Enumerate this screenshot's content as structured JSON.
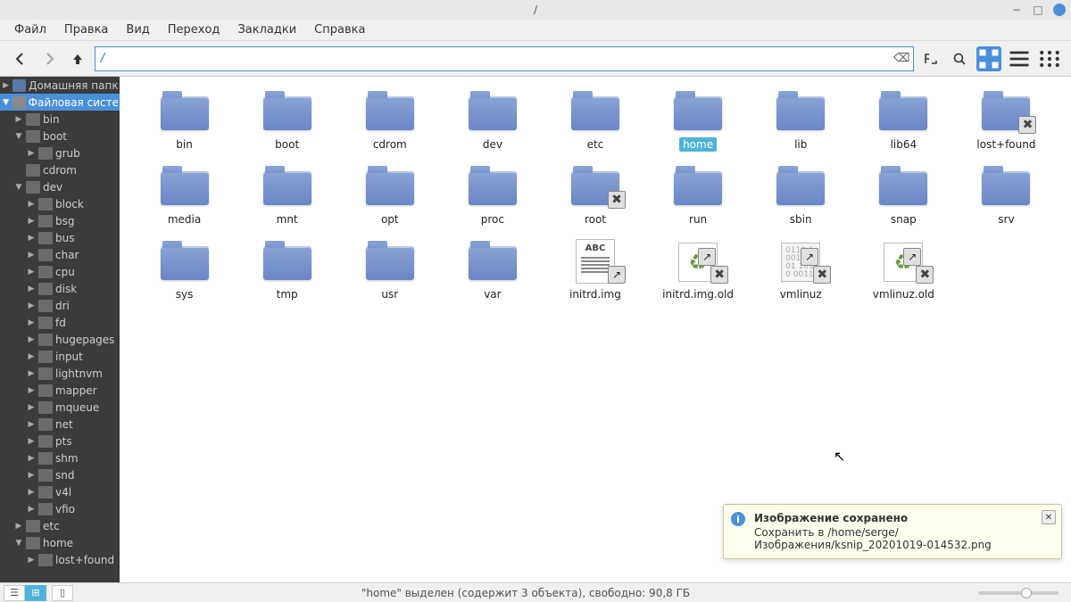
{
  "window": {
    "title": "/"
  },
  "menu": [
    "Файл",
    "Правка",
    "Вид",
    "Переход",
    "Закладки",
    "Справка"
  ],
  "path": {
    "value": "/"
  },
  "tree": [
    {
      "d": 0,
      "label": "Домашняя папка",
      "icon": "home",
      "arrow": "col",
      "sel": false
    },
    {
      "d": 0,
      "label": "Файловая систем",
      "icon": "hdd",
      "arrow": "exp",
      "sel": true
    },
    {
      "d": 1,
      "label": "bin",
      "icon": "folder",
      "arrow": "col",
      "sel": false
    },
    {
      "d": 1,
      "label": "boot",
      "icon": "folder",
      "arrow": "exp",
      "sel": false
    },
    {
      "d": 2,
      "label": "grub",
      "icon": "folder",
      "arrow": "col",
      "sel": false
    },
    {
      "d": 1,
      "label": "cdrom",
      "icon": "folder",
      "arrow": "none",
      "sel": false
    },
    {
      "d": 1,
      "label": "dev",
      "icon": "folder",
      "arrow": "exp",
      "sel": false
    },
    {
      "d": 2,
      "label": "block",
      "icon": "folder",
      "arrow": "col",
      "sel": false
    },
    {
      "d": 2,
      "label": "bsg",
      "icon": "folder",
      "arrow": "col",
      "sel": false
    },
    {
      "d": 2,
      "label": "bus",
      "icon": "folder",
      "arrow": "col",
      "sel": false
    },
    {
      "d": 2,
      "label": "char",
      "icon": "folder",
      "arrow": "col",
      "sel": false
    },
    {
      "d": 2,
      "label": "cpu",
      "icon": "folder",
      "arrow": "col",
      "sel": false
    },
    {
      "d": 2,
      "label": "disk",
      "icon": "folder",
      "arrow": "col",
      "sel": false
    },
    {
      "d": 2,
      "label": "dri",
      "icon": "folder",
      "arrow": "col",
      "sel": false
    },
    {
      "d": 2,
      "label": "fd",
      "icon": "folder",
      "arrow": "col",
      "sel": false
    },
    {
      "d": 2,
      "label": "hugepages",
      "icon": "folder",
      "arrow": "col",
      "sel": false
    },
    {
      "d": 2,
      "label": "input",
      "icon": "folder",
      "arrow": "col",
      "sel": false
    },
    {
      "d": 2,
      "label": "lightnvm",
      "icon": "folder",
      "arrow": "col",
      "sel": false
    },
    {
      "d": 2,
      "label": "mapper",
      "icon": "folder",
      "arrow": "col",
      "sel": false
    },
    {
      "d": 2,
      "label": "mqueue",
      "icon": "folder",
      "arrow": "col",
      "sel": false
    },
    {
      "d": 2,
      "label": "net",
      "icon": "folder",
      "arrow": "col",
      "sel": false
    },
    {
      "d": 2,
      "label": "pts",
      "icon": "folder",
      "arrow": "col",
      "sel": false
    },
    {
      "d": 2,
      "label": "shm",
      "icon": "folder",
      "arrow": "col",
      "sel": false
    },
    {
      "d": 2,
      "label": "snd",
      "icon": "folder",
      "arrow": "col",
      "sel": false
    },
    {
      "d": 2,
      "label": "v4l",
      "icon": "folder",
      "arrow": "col",
      "sel": false
    },
    {
      "d": 2,
      "label": "vfio",
      "icon": "folder",
      "arrow": "col",
      "sel": false
    },
    {
      "d": 1,
      "label": "etc",
      "icon": "folder",
      "arrow": "col",
      "sel": false
    },
    {
      "d": 1,
      "label": "home",
      "icon": "folder",
      "arrow": "exp",
      "sel": false
    },
    {
      "d": 2,
      "label": "lost+found",
      "icon": "lost",
      "arrow": "col",
      "sel": false
    }
  ],
  "icons": [
    {
      "label": "bin",
      "type": "folder"
    },
    {
      "label": "boot",
      "type": "folder"
    },
    {
      "label": "cdrom",
      "type": "folder"
    },
    {
      "label": "dev",
      "type": "folder"
    },
    {
      "label": "etc",
      "type": "folder"
    },
    {
      "label": "home",
      "type": "folder",
      "sel": true
    },
    {
      "label": "lib",
      "type": "folder"
    },
    {
      "label": "lib64",
      "type": "folder"
    },
    {
      "label": "lost+found",
      "type": "folder",
      "locked": true
    },
    {
      "label": "media",
      "type": "folder"
    },
    {
      "label": "mnt",
      "type": "folder"
    },
    {
      "label": "opt",
      "type": "folder"
    },
    {
      "label": "proc",
      "type": "folder"
    },
    {
      "label": "root",
      "type": "folder",
      "locked": true
    },
    {
      "label": "run",
      "type": "folder"
    },
    {
      "label": "sbin",
      "type": "folder"
    },
    {
      "label": "snap",
      "type": "folder"
    },
    {
      "label": "srv",
      "type": "folder"
    },
    {
      "label": "sys",
      "type": "folder"
    },
    {
      "label": "tmp",
      "type": "folder"
    },
    {
      "label": "usr",
      "type": "folder"
    },
    {
      "label": "var",
      "type": "folder"
    },
    {
      "label": "initrd.img",
      "type": "textlink",
      "badge": "ABC"
    },
    {
      "label": "initrd.img.old",
      "type": "recyclelink"
    },
    {
      "label": "vmlinuz",
      "type": "binlink"
    },
    {
      "label": "vmlinuz.old",
      "type": "recyclelink"
    }
  ],
  "status": "\"home\" выделен (содержит 3 объекта), свободно: 90,8 ГБ",
  "toast": {
    "title": "Изображение сохранено",
    "body": "Сохранить в /home/serge/Изображения/ksnip_20201019-014532.png"
  }
}
